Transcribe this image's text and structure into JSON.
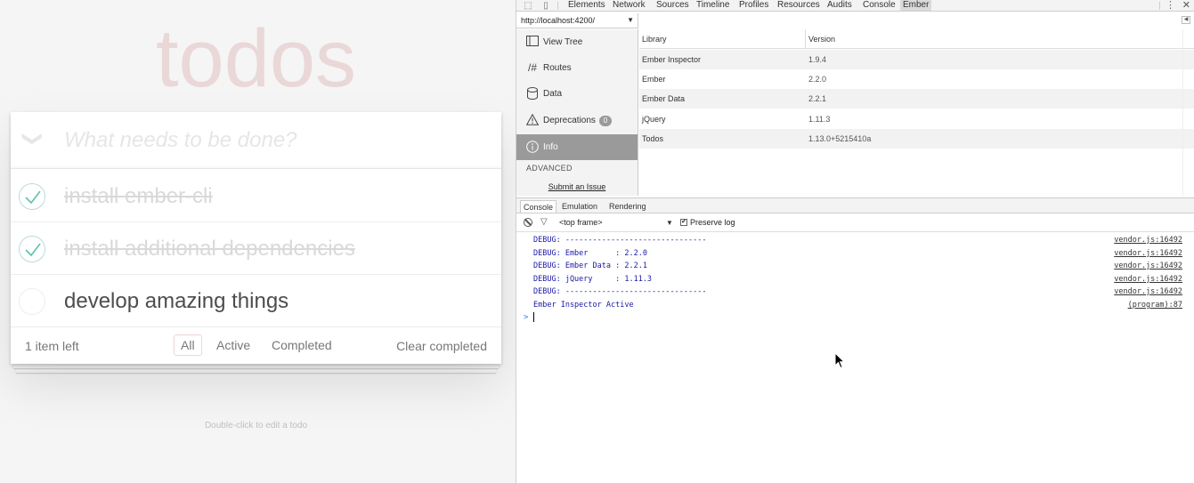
{
  "app": {
    "title": "todos",
    "new_todo_placeholder": "What needs to be done?",
    "toggle_all_glyph": "❯",
    "todos": [
      {
        "label": "install ember-cli",
        "completed": true
      },
      {
        "label": "install additional dependencies",
        "completed": true
      },
      {
        "label": "develop amazing things",
        "completed": false
      }
    ],
    "footer": {
      "count_text": "1 item left",
      "filters": [
        "All",
        "Active",
        "Completed"
      ],
      "selected_filter": "All",
      "clear_label": "Clear completed"
    },
    "hint": "Double-click to edit a todo",
    "colors": {
      "title": "#af2f2f",
      "check": "#5dc2af"
    }
  },
  "devtools": {
    "tabs": [
      "Elements",
      "Network",
      "Sources",
      "Timeline",
      "Profiles",
      "Resources",
      "Audits",
      "Console",
      "Ember"
    ],
    "active_tab": "Ember",
    "icons": {
      "inspect": "inspect-icon",
      "device": "device-icon",
      "menu": "kebab-menu-icon",
      "close": "close-icon"
    },
    "url": "http://localhost:4200/",
    "nav": [
      {
        "label": "View Tree",
        "icon": "view-tree-icon"
      },
      {
        "label": "Routes",
        "icon": "routes-icon"
      },
      {
        "label": "Data",
        "icon": "data-icon"
      },
      {
        "label": "Deprecations",
        "icon": "warning-icon",
        "badge": "0"
      },
      {
        "label": "Info",
        "icon": "info-icon",
        "active": true
      }
    ],
    "nav_section": "ADVANCED",
    "submit_issue": "Submit an Issue",
    "table": {
      "headers": [
        "Library",
        "Version"
      ],
      "rows": [
        [
          "Ember Inspector",
          "1.9.4"
        ],
        [
          "Ember",
          "2.2.0"
        ],
        [
          "Ember Data",
          "2.2.1"
        ],
        [
          "jQuery",
          "1.11.3"
        ],
        [
          "Todos",
          "1.13.0+5215410a"
        ]
      ]
    },
    "drawer_tabs": [
      "Console",
      "Emulation",
      "Rendering"
    ],
    "console": {
      "frame": "<top frame>",
      "preserve_log_label": "Preserve log",
      "preserve_log_checked": true,
      "lines": [
        {
          "msg": "DEBUG: -------------------------------",
          "src": "vendor.js:16492"
        },
        {
          "msg": "DEBUG: Ember      : 2.2.0",
          "src": "vendor.js:16492"
        },
        {
          "msg": "DEBUG: Ember Data : 2.2.1",
          "src": "vendor.js:16492"
        },
        {
          "msg": "DEBUG: jQuery     : 1.11.3",
          "src": "vendor.js:16492"
        },
        {
          "msg": "DEBUG: -------------------------------",
          "src": "vendor.js:16492"
        },
        {
          "msg": "Ember Inspector Active",
          "src": "(program):87"
        }
      ],
      "prompt": ">"
    }
  }
}
